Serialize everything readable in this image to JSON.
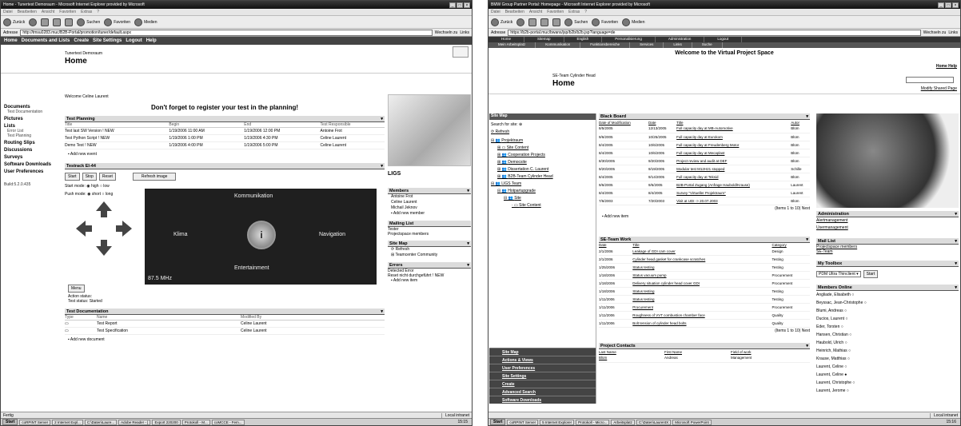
{
  "winA": {
    "title": "Home - Tunertest Demoraum - Microsoft Internet Explorer provided by Microsoft",
    "menu": [
      "Datei",
      "Bearbeiten",
      "Ansicht",
      "Favoriten",
      "Extras",
      "?"
    ],
    "toolbar": {
      "back": "Zurück",
      "search": "Suchen",
      "favorites": "Favoriten",
      "media": "Medien"
    },
    "address_label": "Adresse",
    "address": "http://tmsu0283.muc/B2B-Portal/promotion/tuner/default.aspx",
    "go": "Wechseln zu",
    "links": "Links",
    "nav": [
      "Home",
      "Documents and Lists",
      "Create",
      "Site Settings",
      "Logout",
      "Help"
    ],
    "header_sub": "Tunertest Demoraum",
    "header_title": "Home",
    "welcome": "Welcome Celine Laurent",
    "reminder": "Don't forget to register your test in the planning!",
    "leftnav": {
      "documents": "Documents",
      "test_doc": "Test Documentation",
      "pictures": "Pictures",
      "lists": "Lists",
      "error_list": "Error List",
      "test_planning": "Test Planning",
      "routing": "Routing Slips",
      "discussions": "Discussions",
      "surveys": "Surveys",
      "software": "Software Downloads",
      "prefs": "User Preferences",
      "build": "Build:5.2.0.435"
    },
    "planning": {
      "title": "Test Planning",
      "cols": [
        "Title",
        "Begin",
        "End",
        "Test Responsible"
      ],
      "rows": [
        [
          "Test last SW Version ! NEW",
          "1/19/2006 11:00 AM",
          "1/19/2006 12:00 PM",
          "Antoine Frot"
        ],
        [
          "Test Python Script ! NEW",
          "1/19/2006 1:00 PM",
          "1/19/2006 4:30 PM",
          "Celine Laurent"
        ],
        [
          "Demo Test ! NEW",
          "1/19/2006 4:00 PM",
          "1/19/2006 5:00 PM",
          "Celine Laurent"
        ]
      ],
      "add": "Add new event"
    },
    "testrack": {
      "title": "Testrack EI-44",
      "start": "Start",
      "stop": "Stop",
      "reset": "Reset",
      "refresh": "Refresh image",
      "start_mode": "Start mode:",
      "high": "high",
      "low": "low",
      "push_mode": "Push mode:",
      "short": "short",
      "long": "long",
      "kommunikation": "Kommunikation",
      "klima": "Klima",
      "navigation": "Navigation",
      "entertainment": "Entertainment",
      "knob": "i",
      "freq": "87.5 MHz",
      "menu": "Menu",
      "action_status": "Action status:",
      "test_status_label": "Test status:",
      "test_status": "Started"
    },
    "testdoc": {
      "title": "Test Documentation",
      "cols": [
        "Type",
        "Name",
        "Modified By"
      ],
      "rows": [
        [
          "Test Report",
          "Celine Laurent"
        ],
        [
          "Test Specification",
          "Celine Laurent"
        ]
      ],
      "add": "Add new document"
    },
    "right": {
      "logo": "LIGS",
      "members_title": "Members",
      "members": [
        "Antoine Frot",
        "Celine Laurent",
        "Michail Jeknov"
      ],
      "add_member": "Add new member",
      "mailing_title": "Mailing List",
      "mailing": [
        "Tester",
        "Projectspace members"
      ],
      "sitemap_title": "Site Map",
      "refresh": "Refresh",
      "teamcenter": "Teamcenter Community",
      "errors_title": "Errors",
      "errors": [
        "Detected Error",
        "Reset nicht durchgeführt ! NEW"
      ],
      "add_item": "Add new item"
    },
    "status": {
      "left": "Fertig",
      "right": "Local intranet"
    },
    "taskbar": [
      "Start",
      "coRPINT Server",
      "2 Internet Expl...",
      "C:\\Daten\\Laure...",
      "Adobe Reader - [",
      "Export 220200",
      "Protokoll - M...",
      "coMCCE - Fem..."
    ],
    "clock": "15:15"
  },
  "winB": {
    "title": "BMW Group Partner Portal: Homepage - Microsoft Internet Explorer provided by Microsoft",
    "menu": [
      "Datei",
      "Bearbeiten",
      "Ansicht",
      "Favoriten",
      "Extras",
      "?"
    ],
    "toolbar": {
      "back": "Zurück",
      "search": "Suchen",
      "favorites": "Favoriten",
      "media": "Medien"
    },
    "address_label": "Adresse",
    "address": "https://b2b-portal.muc/bwans/jsp/b2b/b2b.jsp?language=de",
    "go": "Wechseln zu",
    "links": "Links",
    "nav1": [
      "Home",
      "Sitemap",
      "English",
      "Personalisierung",
      "Administration",
      "Logout"
    ],
    "nav2": [
      "Mein Arbeitsplatz",
      "Kommunikation",
      "Funktionsbereiche",
      "Services",
      "Links",
      "Suche"
    ],
    "welcome": "Welcome to the Virtual Project Space",
    "top_links": "Home  Help",
    "header_sub": "SE-Team Cylinder Head",
    "header_title": "Home",
    "modify": "Modify Shared Page",
    "sitemap": {
      "title": "Site Map",
      "search_label": "Search for site:",
      "refresh": "Refresh",
      "tree": [
        "Projektraum",
        "Site Content",
        "Cooperation Projects",
        "Democsite",
        "Dissertation C. Laurent",
        "B2B-Team Cylinder Head",
        "LIGS Team",
        "Hotpartupgrade",
        "Site",
        "Site Content"
      ],
      "bottom": [
        "Site Map",
        "Actions & Views",
        "User Preferences",
        "Site Settings",
        "Create",
        "Advanced Search",
        "Software Downloads"
      ]
    },
    "blackboard": {
      "title": "Black Board",
      "cols": [
        "Date of Modification",
        "Date",
        "Title",
        "Autor"
      ],
      "rows": [
        [
          "8/5/2005",
          "12/13/2005",
          "Full capacity day at MB-Automotive",
          "Blüm"
        ],
        [
          "9/6/2005",
          "10/25/2005",
          "Full capacity day at Eurokom",
          "Blüm"
        ],
        [
          "8/4/2005",
          "10/6/2005",
          "Full capacity day at Freudenberg Motor",
          "Blüm"
        ],
        [
          "8/4/2005",
          "10/6/2005",
          "Full capacity day at Mecaplast",
          "Blüm"
        ],
        [
          "8/30/2005",
          "9/20/2005",
          "Project review and audit at DEF",
          "Blüm"
        ],
        [
          "9/20/2005",
          "9/19/2005",
          "Modular test M12H21 stopped",
          "Schille"
        ],
        [
          "8/4/2005",
          "9/14/2005",
          "Full capacity day at Teksid",
          "Blüm"
        ],
        [
          "9/6/2005",
          "9/6/2005",
          "B2B-Portal Zugang (Anfrage Haubold/Krause)",
          "Laurent"
        ],
        [
          "8/4/2005",
          "8/4/2005",
          "Survey \"Virtueller Projektraum\"",
          "Laurent"
        ],
        [
          "7/6/2003",
          "7/20/2003",
          "Visit at UDI -> 20.07.2003",
          "Blüm"
        ]
      ],
      "paging": "(Items 1 to 10) Next",
      "add": "Add new item"
    },
    "seteam": {
      "title": "SE-Team Work",
      "cols": [
        "Date",
        "Title",
        "Category"
      ],
      "rows": [
        [
          "2/1/2006",
          "Leakage of GDI cam cover",
          "Design"
        ],
        [
          "2/1/2006",
          "Cylinder head gasket for crankcase scratches",
          "Testing"
        ],
        [
          "1/25/2006",
          "Status testing",
          "Testing"
        ],
        [
          "1/18/2006",
          "Status vacuum pump",
          "Procurement"
        ],
        [
          "1/18/2006",
          "Delivery situation cylinder head cover GDI",
          "Procurement"
        ],
        [
          "1/18/2006",
          "Status testing",
          "Testing"
        ],
        [
          "1/11/2006",
          "Status testing",
          "Testing"
        ],
        [
          "1/11/2006",
          "Procurement",
          "Procurement"
        ],
        [
          "1/11/2006",
          "Roughness of VVT combustion chamber face",
          "Quality"
        ],
        [
          "1/11/2006",
          "Bolt tension of cylinder head bolts",
          "Quality"
        ]
      ],
      "paging": "(Items 1 to 10) Next"
    },
    "contacts": {
      "title": "Project Contacts",
      "cols": [
        "Last Name",
        "First Name",
        "Field of work"
      ],
      "rows": [
        [
          "Blüm",
          "Andreas",
          "Management"
        ]
      ]
    },
    "right": {
      "admin_title": "Administration",
      "admin": [
        "Alertmanagement",
        "Usermanagement"
      ],
      "mail_title": "Mail List",
      "mail": [
        "Projectspace members",
        "SE-Team"
      ],
      "toolbox_title": "My Toolbox",
      "toolbox_select": "PDM Ultra Thinclient",
      "toolbox_start": "Start",
      "members_title": "Members Online",
      "members": [
        "Angliade, Elisabeth",
        "Beyssac, Jean-Christophe",
        "Blumi, Andreas",
        "Ducios, Laurent",
        "Eder, Torsten",
        "Hansen, Christian",
        "Haubold, Ulrich",
        "Heinrich, Mathias",
        "Krause, Matthias",
        "Laurent, Celine",
        "Laurent, Celine",
        "Laurent, Christophe",
        "Laurent, Jerome"
      ]
    },
    "status": {
      "right": "Local intranet"
    },
    "taskbar": [
      "Start",
      "coRPINT Server",
      "5 Internet Explorer",
      "Protokoll - Micro...",
      "Arbeitsplatz",
      "C:\\Daten\\LaurentX",
      "Microsoft PowerPoint"
    ],
    "clock": "15:16"
  }
}
